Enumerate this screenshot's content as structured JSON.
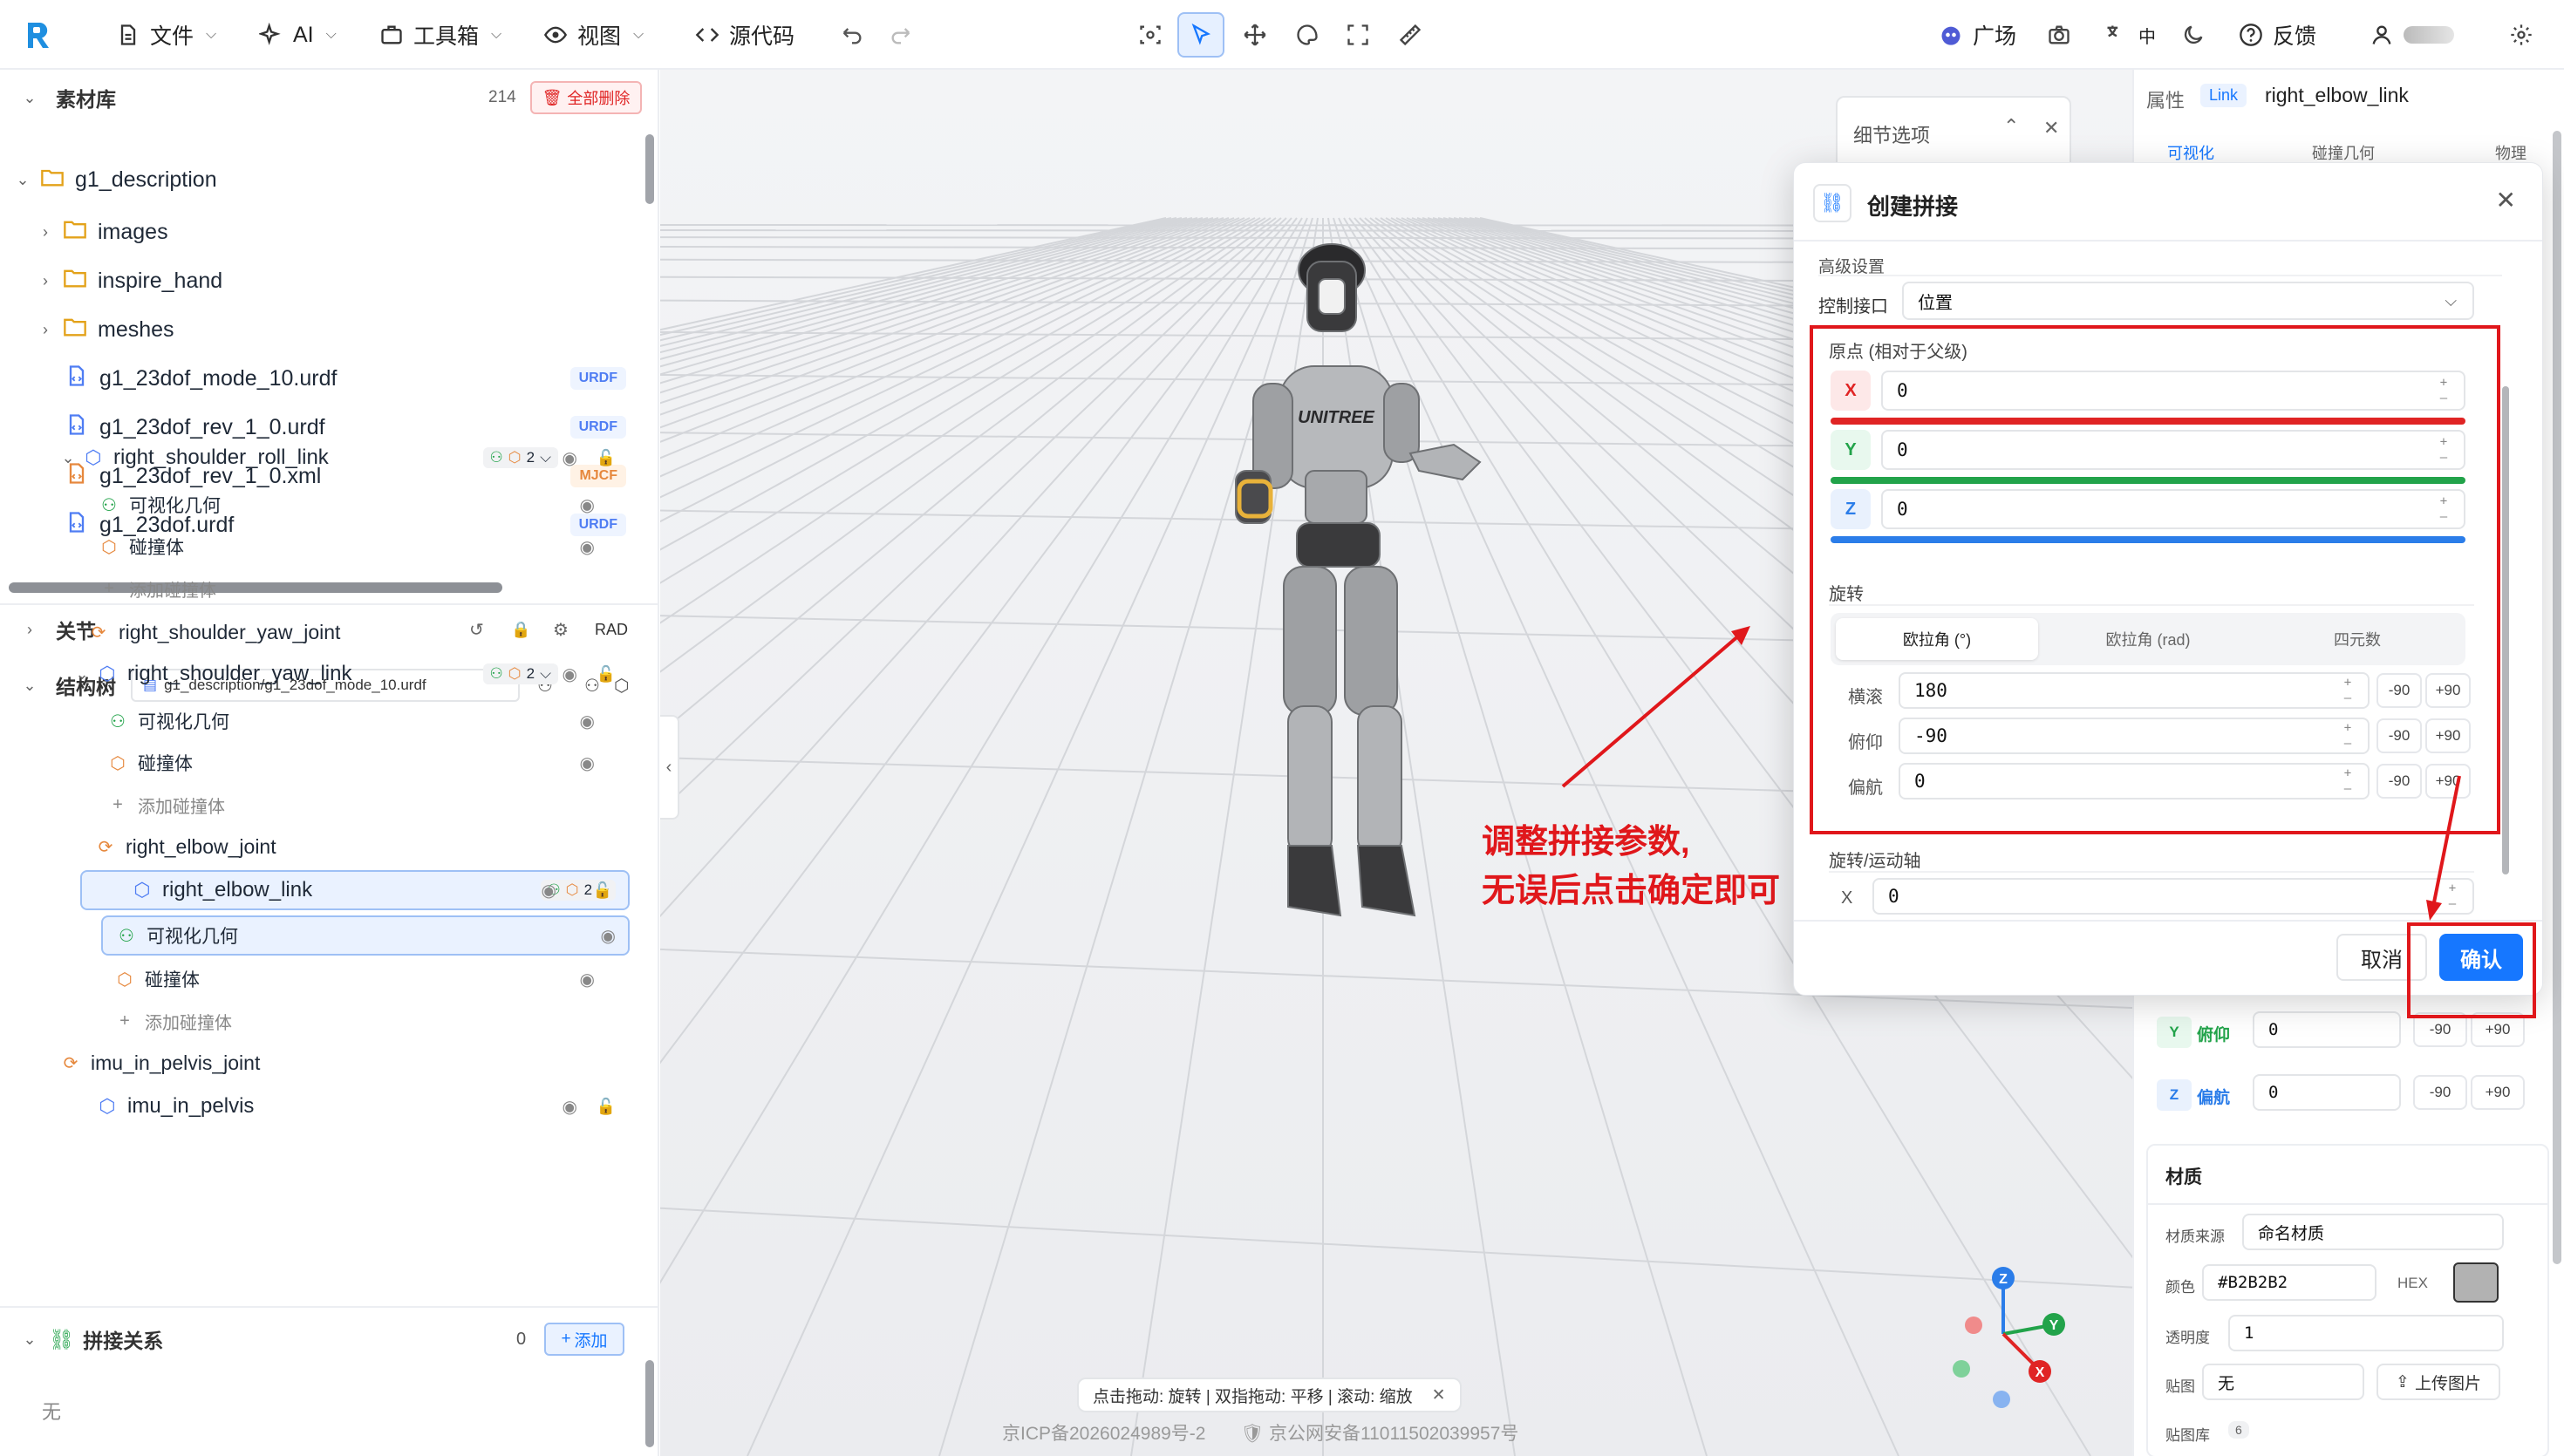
{
  "toolbar": {
    "file": "文件",
    "ai": "AI",
    "toolbox": "工具箱",
    "view": "视图",
    "source": "源代码",
    "plaza": "广场",
    "feedback": "反馈",
    "lang": "中"
  },
  "assets": {
    "title": "素材库",
    "count": "214",
    "delete_all": "全部删除",
    "root_folder": "g1_description",
    "items": [
      {
        "label": "images",
        "kind": "folder"
      },
      {
        "label": "inspire_hand",
        "kind": "folder"
      },
      {
        "label": "meshes",
        "kind": "folder"
      },
      {
        "label": "g1_23dof_mode_10.urdf",
        "kind": "file",
        "badge": "URDF"
      },
      {
        "label": "g1_23dof_rev_1_0.urdf",
        "kind": "file",
        "badge": "URDF"
      },
      {
        "label": "g1_23dof_rev_1_0.xml",
        "kind": "file",
        "badge": "MJCF"
      },
      {
        "label": "g1_23dof.urdf",
        "kind": "file",
        "badge": "URDF"
      }
    ]
  },
  "joints": {
    "title": "关节",
    "unit": "RAD"
  },
  "structure": {
    "title": "结构树",
    "file_path": "g1_description/g1_23dof_mode_10.urdf",
    "rows": [
      {
        "label": "right_shoulder_roll_link",
        "count": "2"
      },
      {
        "label": "可视化几何"
      },
      {
        "label": "碰撞体"
      },
      {
        "label": "添加碰撞体"
      },
      {
        "label": "right_shoulder_yaw_joint"
      },
      {
        "label": "right_shoulder_yaw_link",
        "count": "2"
      },
      {
        "label": "可视化几何"
      },
      {
        "label": "碰撞体"
      },
      {
        "label": "添加碰撞体"
      },
      {
        "label": "right_elbow_joint"
      },
      {
        "label": "right_elbow_link",
        "count": "2"
      },
      {
        "label": "可视化几何"
      },
      {
        "label": "碰撞体"
      },
      {
        "label": "添加碰撞体"
      },
      {
        "label": "imu_in_pelvis_joint"
      },
      {
        "label": "imu_in_pelvis"
      }
    ]
  },
  "splice": {
    "title": "拼接关系",
    "count": "0",
    "add": "添加",
    "empty": "无"
  },
  "viewport": {
    "hint": "点击拖动: 旋转 | 双指拖动: 平移 | 滚动: 缩放",
    "icp": "京ICP备2026024989号-2",
    "police": "京公网安备11011502039957号",
    "detail_panel_title": "细节选项",
    "robot_brand": "UNITREE",
    "annotation_line1": "调整拼接参数,",
    "annotation_line2": "无误后点击确定即可",
    "axes": {
      "x": "X",
      "y": "Y",
      "z": "Z"
    }
  },
  "properties": {
    "title": "属性",
    "type_badge": "Link",
    "name": "right_elbow_link",
    "tabs": [
      "可视化",
      "碰撞几何",
      "物理"
    ],
    "pitch_label": "俯仰",
    "yaw_label": "偏航",
    "pitch_value": "0",
    "yaw_value": "0",
    "minus90": "-90",
    "plus90": "+90",
    "material_title": "材质",
    "material_source_label": "材质来源",
    "material_source": "命名材质",
    "color_label": "颜色",
    "color_value": "#B2B2B2",
    "hex": "HEX",
    "opacity_label": "透明度",
    "opacity_value": "1",
    "texture_label": "贴图",
    "texture_value": "无",
    "upload": "上传图片",
    "texture_lib": "贴图库",
    "texture_lib_count": "6"
  },
  "dialog": {
    "title": "创建拼接",
    "advanced": "高级设置",
    "control_label": "控制接口",
    "control_value": "位置",
    "origin_title": "原点 (相对于父级)",
    "x_label": "X",
    "x_value": "0",
    "y_label": "Y",
    "y_value": "0",
    "z_label": "Z",
    "z_value": "0",
    "rotation_title": "旋转",
    "rot_tabs": [
      "欧拉角 (°)",
      "欧拉角 (rad)",
      "四元数"
    ],
    "roll_label": "横滚",
    "roll_value": "180",
    "pitch_label": "俯仰",
    "pitch_value": "-90",
    "yaw_label": "偏航",
    "yaw_value": "0",
    "minus90": "-90",
    "plus90": "+90",
    "axis_title": "旋转/运动轴",
    "axis_x_label": "X",
    "axis_x_value": "0",
    "cancel": "取消",
    "confirm": "确认"
  },
  "colors": {
    "accent": "#1677ff",
    "red": "#e0171b",
    "x_axis": "#e02424",
    "y_axis": "#22a34a",
    "z_axis": "#2b7de9"
  }
}
